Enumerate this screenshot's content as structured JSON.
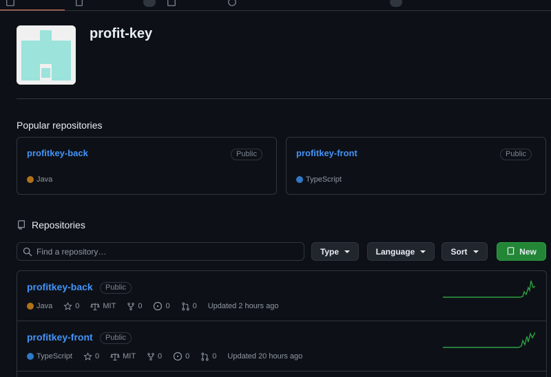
{
  "org": {
    "name": "profit-key"
  },
  "popular": {
    "title": "Popular repositories",
    "repos": [
      {
        "name": "profitkey-back",
        "visibility": "Public",
        "language": "Java",
        "language_color": "#b07219"
      },
      {
        "name": "profitkey-front",
        "visibility": "Public",
        "language": "TypeScript",
        "language_color": "#3178c6"
      }
    ]
  },
  "repositories": {
    "title": "Repositories",
    "search_placeholder": "Find a repository…",
    "type_label": "Type",
    "language_label": "Language",
    "sort_label": "Sort",
    "new_label": "New",
    "rows": [
      {
        "name": "profitkey-back",
        "visibility": "Public",
        "language": "Java",
        "language_color": "#b07219",
        "stars": "0",
        "license": "MIT",
        "forks": "0",
        "issues": "0",
        "pulls": "0",
        "updated": "Updated 2 hours ago"
      },
      {
        "name": "profitkey-front",
        "visibility": "Public",
        "language": "TypeScript",
        "language_color": "#3178c6",
        "stars": "0",
        "license": "MIT",
        "forks": "0",
        "issues": "0",
        "pulls": "0",
        "updated": "Updated 20 hours ago"
      }
    ]
  },
  "colors": {
    "accent_link": "#4493f8",
    "new_button": "#238636",
    "tab_underline": "#f78166",
    "sparkline": "#2ea043"
  }
}
